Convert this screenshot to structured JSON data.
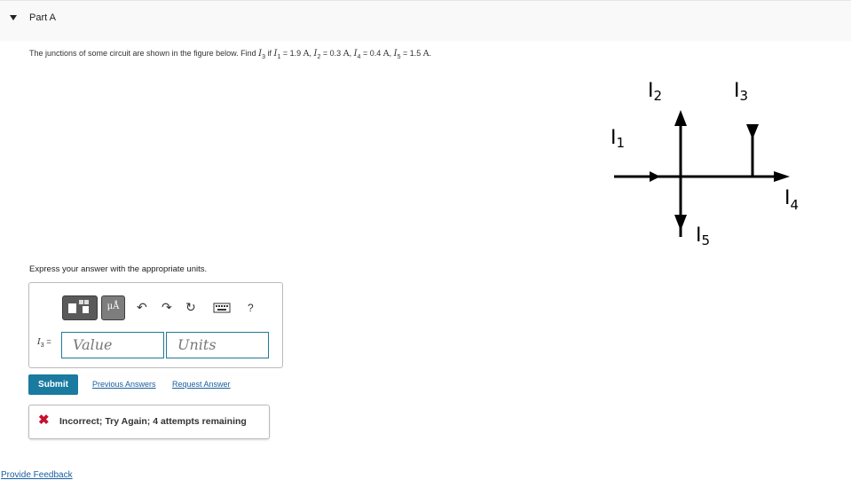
{
  "part": {
    "title": "Part A"
  },
  "question": {
    "text_before": "The junctions of some circuit are shown in the figure below. Find ",
    "target_var": "I",
    "target_sub": "3",
    "text_if": " if ",
    "givens": [
      {
        "var": "I",
        "sub": "1",
        "value": " = 1.9 ",
        "unit": "A"
      },
      {
        "var": "I",
        "sub": "2",
        "value": " = 0.3 ",
        "unit": "A"
      },
      {
        "var": "I",
        "sub": "4",
        "value": " = 0.4 ",
        "unit": "A"
      },
      {
        "var": "I",
        "sub": "5",
        "value": " = 1.5 ",
        "unit": "A"
      }
    ]
  },
  "figure": {
    "labels": [
      {
        "main": "I",
        "sub": "1"
      },
      {
        "main": "I",
        "sub": "2"
      },
      {
        "main": "I",
        "sub": "3"
      },
      {
        "main": "I",
        "sub": "4"
      },
      {
        "main": "I",
        "sub": "5"
      }
    ]
  },
  "instruction": "Express your answer with the appropriate units.",
  "toolbar": {
    "units_label": "μÅ",
    "undo_icon": "undo-icon",
    "redo_icon": "redo-icon",
    "reset_icon": "reset-icon",
    "keyboard_icon": "keyboard-icon",
    "help_label": "?"
  },
  "answer": {
    "var_label_main": "I",
    "var_label_sub": "3",
    "equals": " =",
    "value_placeholder": "Value",
    "units_placeholder": "Units"
  },
  "actions": {
    "submit": "Submit",
    "previous_answers": "Previous Answers",
    "request_answer": "Request Answer"
  },
  "feedback": {
    "status_icon": "x-icon",
    "mark": "✖",
    "message": "Incorrect; Try Again; 4 attempts remaining"
  },
  "footer": {
    "provide_feedback": "Provide Feedback"
  },
  "colors": {
    "accent": "#1a7aa0",
    "link": "#1a5fa0",
    "error": "#c8102e",
    "input_border": "#1f7a99"
  }
}
